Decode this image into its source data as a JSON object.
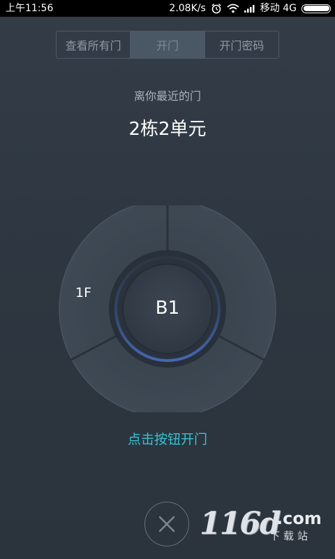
{
  "status_bar": {
    "time": "上午11:56",
    "speed": "2.08K/s",
    "carrier": "移动 4G",
    "icons": [
      "alarm-icon",
      "wifi-icon",
      "signal-icon",
      "battery-icon"
    ]
  },
  "tabs": [
    {
      "label": "查看所有门",
      "active": false
    },
    {
      "label": "开门",
      "active": true
    },
    {
      "label": "开门密码",
      "active": false
    }
  ],
  "nearest_label": "离你最近的门",
  "door_name": "2栋2单元",
  "dial": {
    "floors": [
      "1F"
    ],
    "center_floor": "B1"
  },
  "hint": "点击按钮开门",
  "close_icon": "close-icon",
  "watermark": {
    "main": "116d",
    "suffix": ".com",
    "sub": "下载站"
  },
  "colors": {
    "background": "#2f3842",
    "accent": "#36c3d1",
    "ring_highlight": "#3f61a8"
  }
}
